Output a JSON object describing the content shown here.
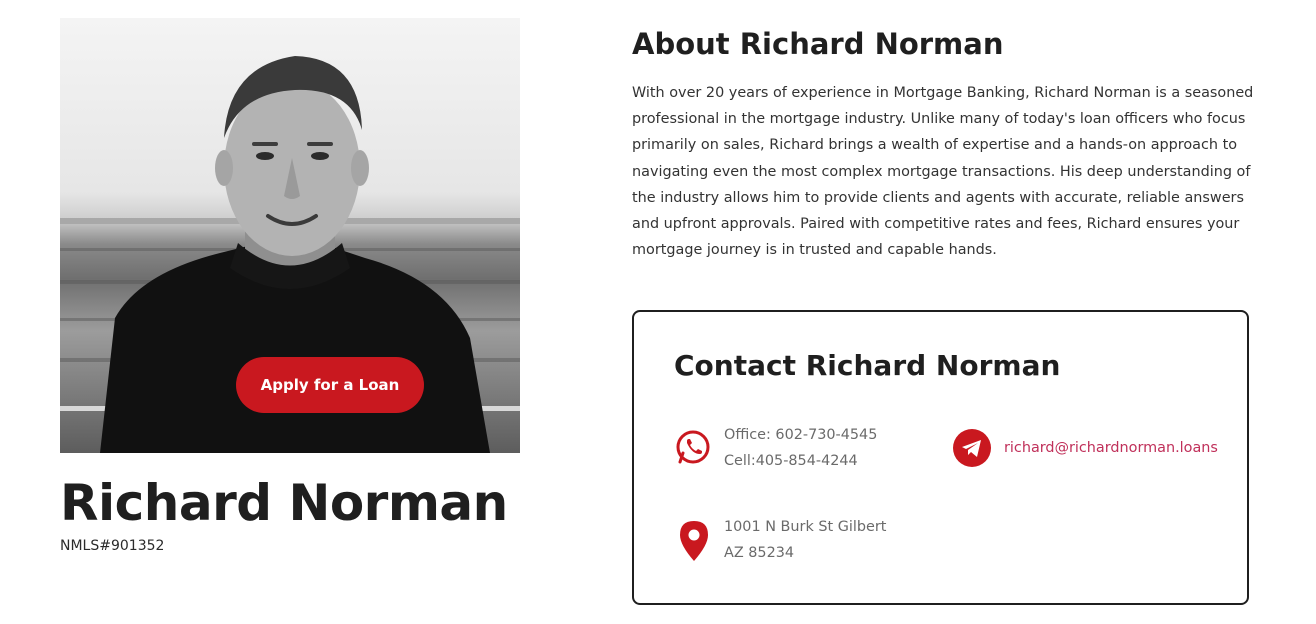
{
  "profile": {
    "apply_label": "Apply for a Loan",
    "name": "Richard Norman",
    "nmls": "NMLS#901352"
  },
  "about": {
    "title": "About Richard Norman",
    "text": "With over 20 years of experience in Mortgage Banking, Richard Norman is a seasoned professional in the mortgage industry. Unlike many of today's loan officers who focus primarily on sales, Richard brings a wealth of expertise and a hands-on approach to navigating even the most complex mortgage transactions. His deep understanding of the industry allows him to provide clients and agents with accurate, reliable answers and upfront approvals. Paired with competitive rates and fees, Richard ensures your mortgage journey is in trusted and capable hands."
  },
  "contact": {
    "title": "Contact Richard Norman",
    "office": "Office: 602-730-4545",
    "cell": "Cell:405-854-4244",
    "email": "richard@richardnorman.loans",
    "address_line1": "1001 N Burk St Gilbert",
    "address_line2": "AZ 85234"
  },
  "colors": {
    "accent": "#c9181f",
    "email_link": "#c0305a",
    "text": "#1f1f1f"
  },
  "icons": [
    "whatsapp-icon",
    "telegram-icon",
    "map-pin-icon"
  ]
}
